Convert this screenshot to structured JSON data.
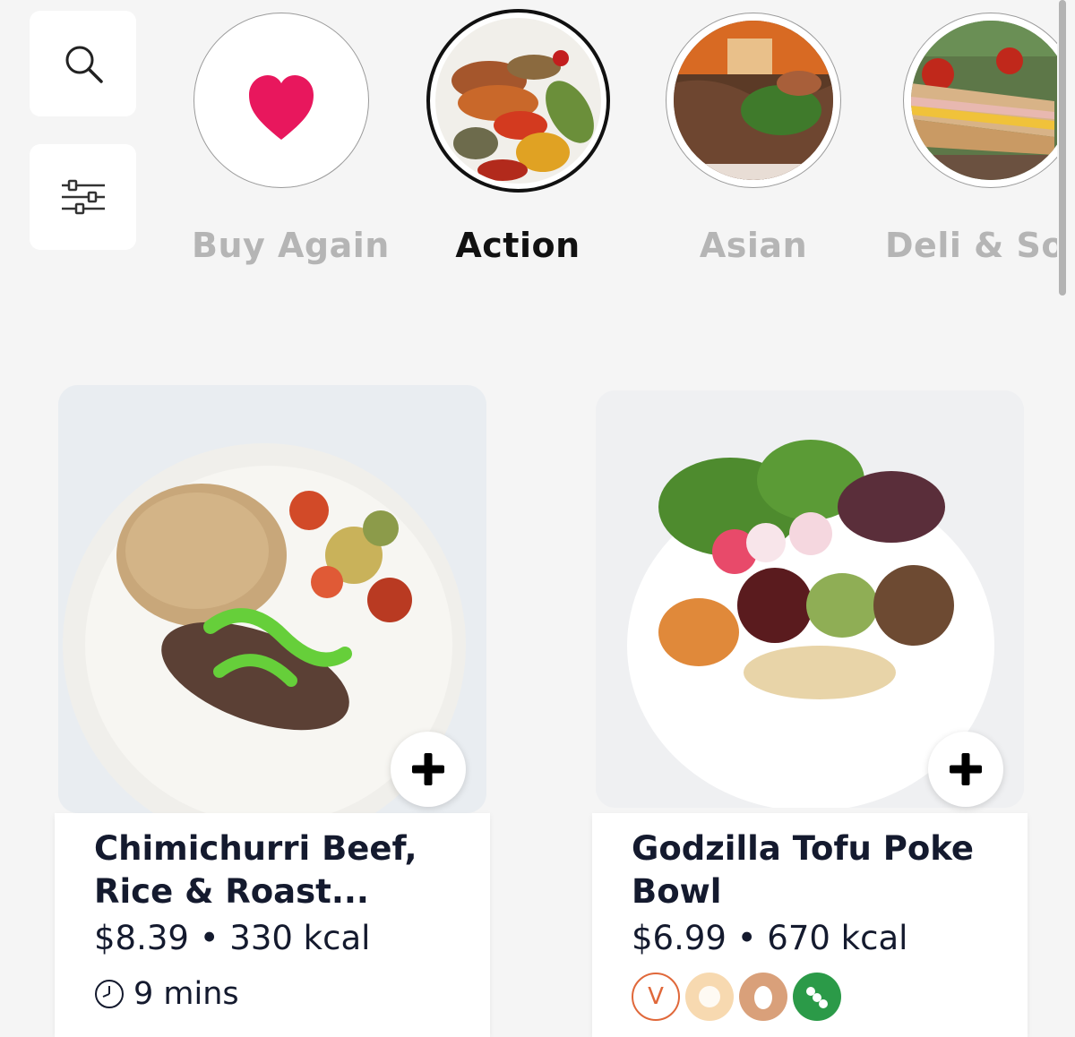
{
  "toolbar": {
    "search_icon": "search-icon",
    "filter_icon": "sliders-icon"
  },
  "categories": [
    {
      "label": "Buy Again",
      "icon": "heart-icon",
      "selected": false
    },
    {
      "label": "Action",
      "icon": "spices-image",
      "selected": true
    },
    {
      "label": "Asian",
      "icon": "noodle-bowl-image",
      "selected": false
    },
    {
      "label": "Deli & Sou",
      "icon": "sandwich-image",
      "selected": false
    }
  ],
  "products": [
    {
      "title": "Chimichurri Beef, Rice & Roast...",
      "price": "$8.39",
      "separator": "•",
      "calories": "330 kcal",
      "time": "9 mins",
      "time_icon": "clock-icon",
      "add_icon": "plus-icon"
    },
    {
      "title": "Godzilla Tofu Poke Bowl",
      "price": "$6.99",
      "separator": "•",
      "calories": "670 kcal",
      "diet_badges": [
        {
          "icon": "vegan-icon",
          "text": "V",
          "color": "#e0683a"
        },
        {
          "icon": "gluten-icon",
          "color": "#f7d9b0"
        },
        {
          "icon": "egg-icon",
          "color": "#d9a07a"
        },
        {
          "icon": "soy-icon",
          "color": "#2b9a48"
        }
      ],
      "add_icon": "plus-icon"
    }
  ],
  "colors": {
    "background": "#f5f5f5",
    "heart": "#e8175d",
    "text": "#141a2e",
    "muted_label": "#b5b5b5"
  }
}
